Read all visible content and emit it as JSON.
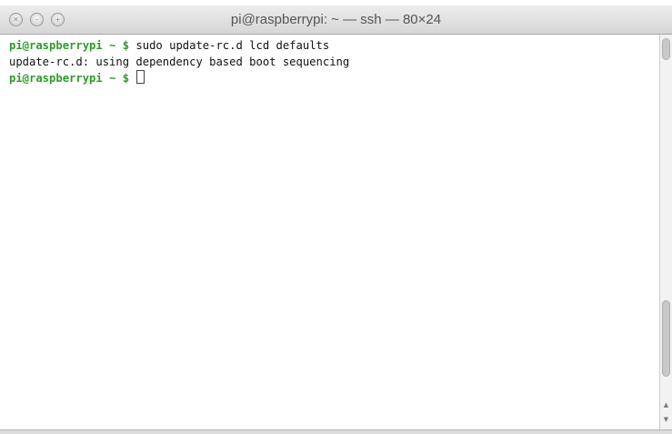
{
  "window": {
    "title": "pi@raspberrypi: ~ — ssh — 80×24",
    "controls": {
      "close_icon": "close-icon",
      "minimize_icon": "minimize-icon",
      "zoom_icon": "zoom-icon"
    }
  },
  "terminal": {
    "lines": [
      {
        "prompt_user": "pi@raspberrypi",
        "prompt_path": " ~ $ ",
        "command": "sudo update-rc.d lcd defaults"
      },
      {
        "output": "update-rc.d: using dependency based boot sequencing"
      },
      {
        "prompt_user": "pi@raspberrypi",
        "prompt_path": " ~ $ ",
        "command": ""
      }
    ]
  },
  "colors": {
    "prompt": "#2c9c2c",
    "text": "#111111",
    "background": "#ffffff"
  }
}
